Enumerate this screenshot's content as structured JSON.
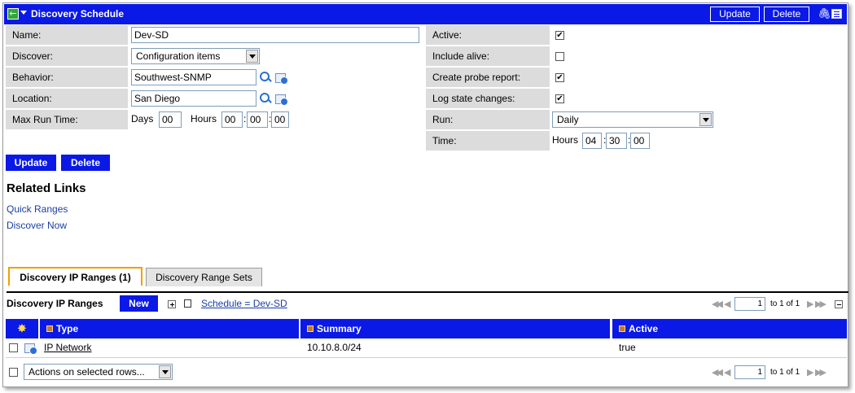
{
  "header": {
    "title": "Discovery Schedule",
    "update_label": "Update",
    "delete_label": "Delete",
    "back_icon": "back-arrow-icon",
    "attach_icon": "paperclip-icon",
    "form_icon": "form-list-icon"
  },
  "form": {
    "name": {
      "label": "Name:",
      "value": "Dev-SD"
    },
    "discover": {
      "label": "Discover:",
      "value": "Configuration items"
    },
    "behavior": {
      "label": "Behavior:",
      "value": "Southwest-SNMP"
    },
    "location": {
      "label": "Location:",
      "value": "San Diego"
    },
    "max_run_time": {
      "label": "Max Run Time:",
      "days_label": "Days",
      "days": "00",
      "hours_label": "Hours",
      "hours": "00",
      "minutes": "00",
      "seconds": "00"
    },
    "active": {
      "label": "Active:",
      "checked": true
    },
    "include_alive": {
      "label": "Include alive:",
      "checked": false
    },
    "create_probe_report": {
      "label": "Create probe report:",
      "checked": true
    },
    "log_state_changes": {
      "label": "Log state changes:",
      "checked": true
    },
    "run": {
      "label": "Run:",
      "value": "Daily"
    },
    "time": {
      "label": "Time:",
      "hours_label": "Hours",
      "hours": "04",
      "minutes": "30",
      "seconds": "00"
    },
    "check_mark": "✔",
    "separator": ":"
  },
  "actions": {
    "update_label": "Update",
    "delete_label": "Delete"
  },
  "related_links": {
    "title": "Related Links",
    "items": [
      "Quick Ranges",
      "Discover Now"
    ]
  },
  "tabs": [
    {
      "label": "Discovery IP Ranges (1)",
      "active": true
    },
    {
      "label": "Discovery Range Sets",
      "active": false
    }
  ],
  "list": {
    "title": "Discovery IP Ranges",
    "new_label": "New",
    "breadcrumb": "Schedule = Dev-SD",
    "pager": {
      "page": "1",
      "text": "to 1 of 1"
    },
    "columns": [
      "Type",
      "Summary",
      "Active"
    ],
    "rows": [
      {
        "type": "IP Network",
        "summary": "10.10.8.0/24",
        "active": "true"
      }
    ],
    "actions_select": "Actions on selected rows...",
    "bottom_pager": {
      "page": "1",
      "text": "to 1 of 1"
    }
  },
  "colors": {
    "accent": "#0a19e6",
    "label_bg": "#dcdcdc",
    "tab_active_border": "#f0a000",
    "link": "#1a3ea8"
  }
}
